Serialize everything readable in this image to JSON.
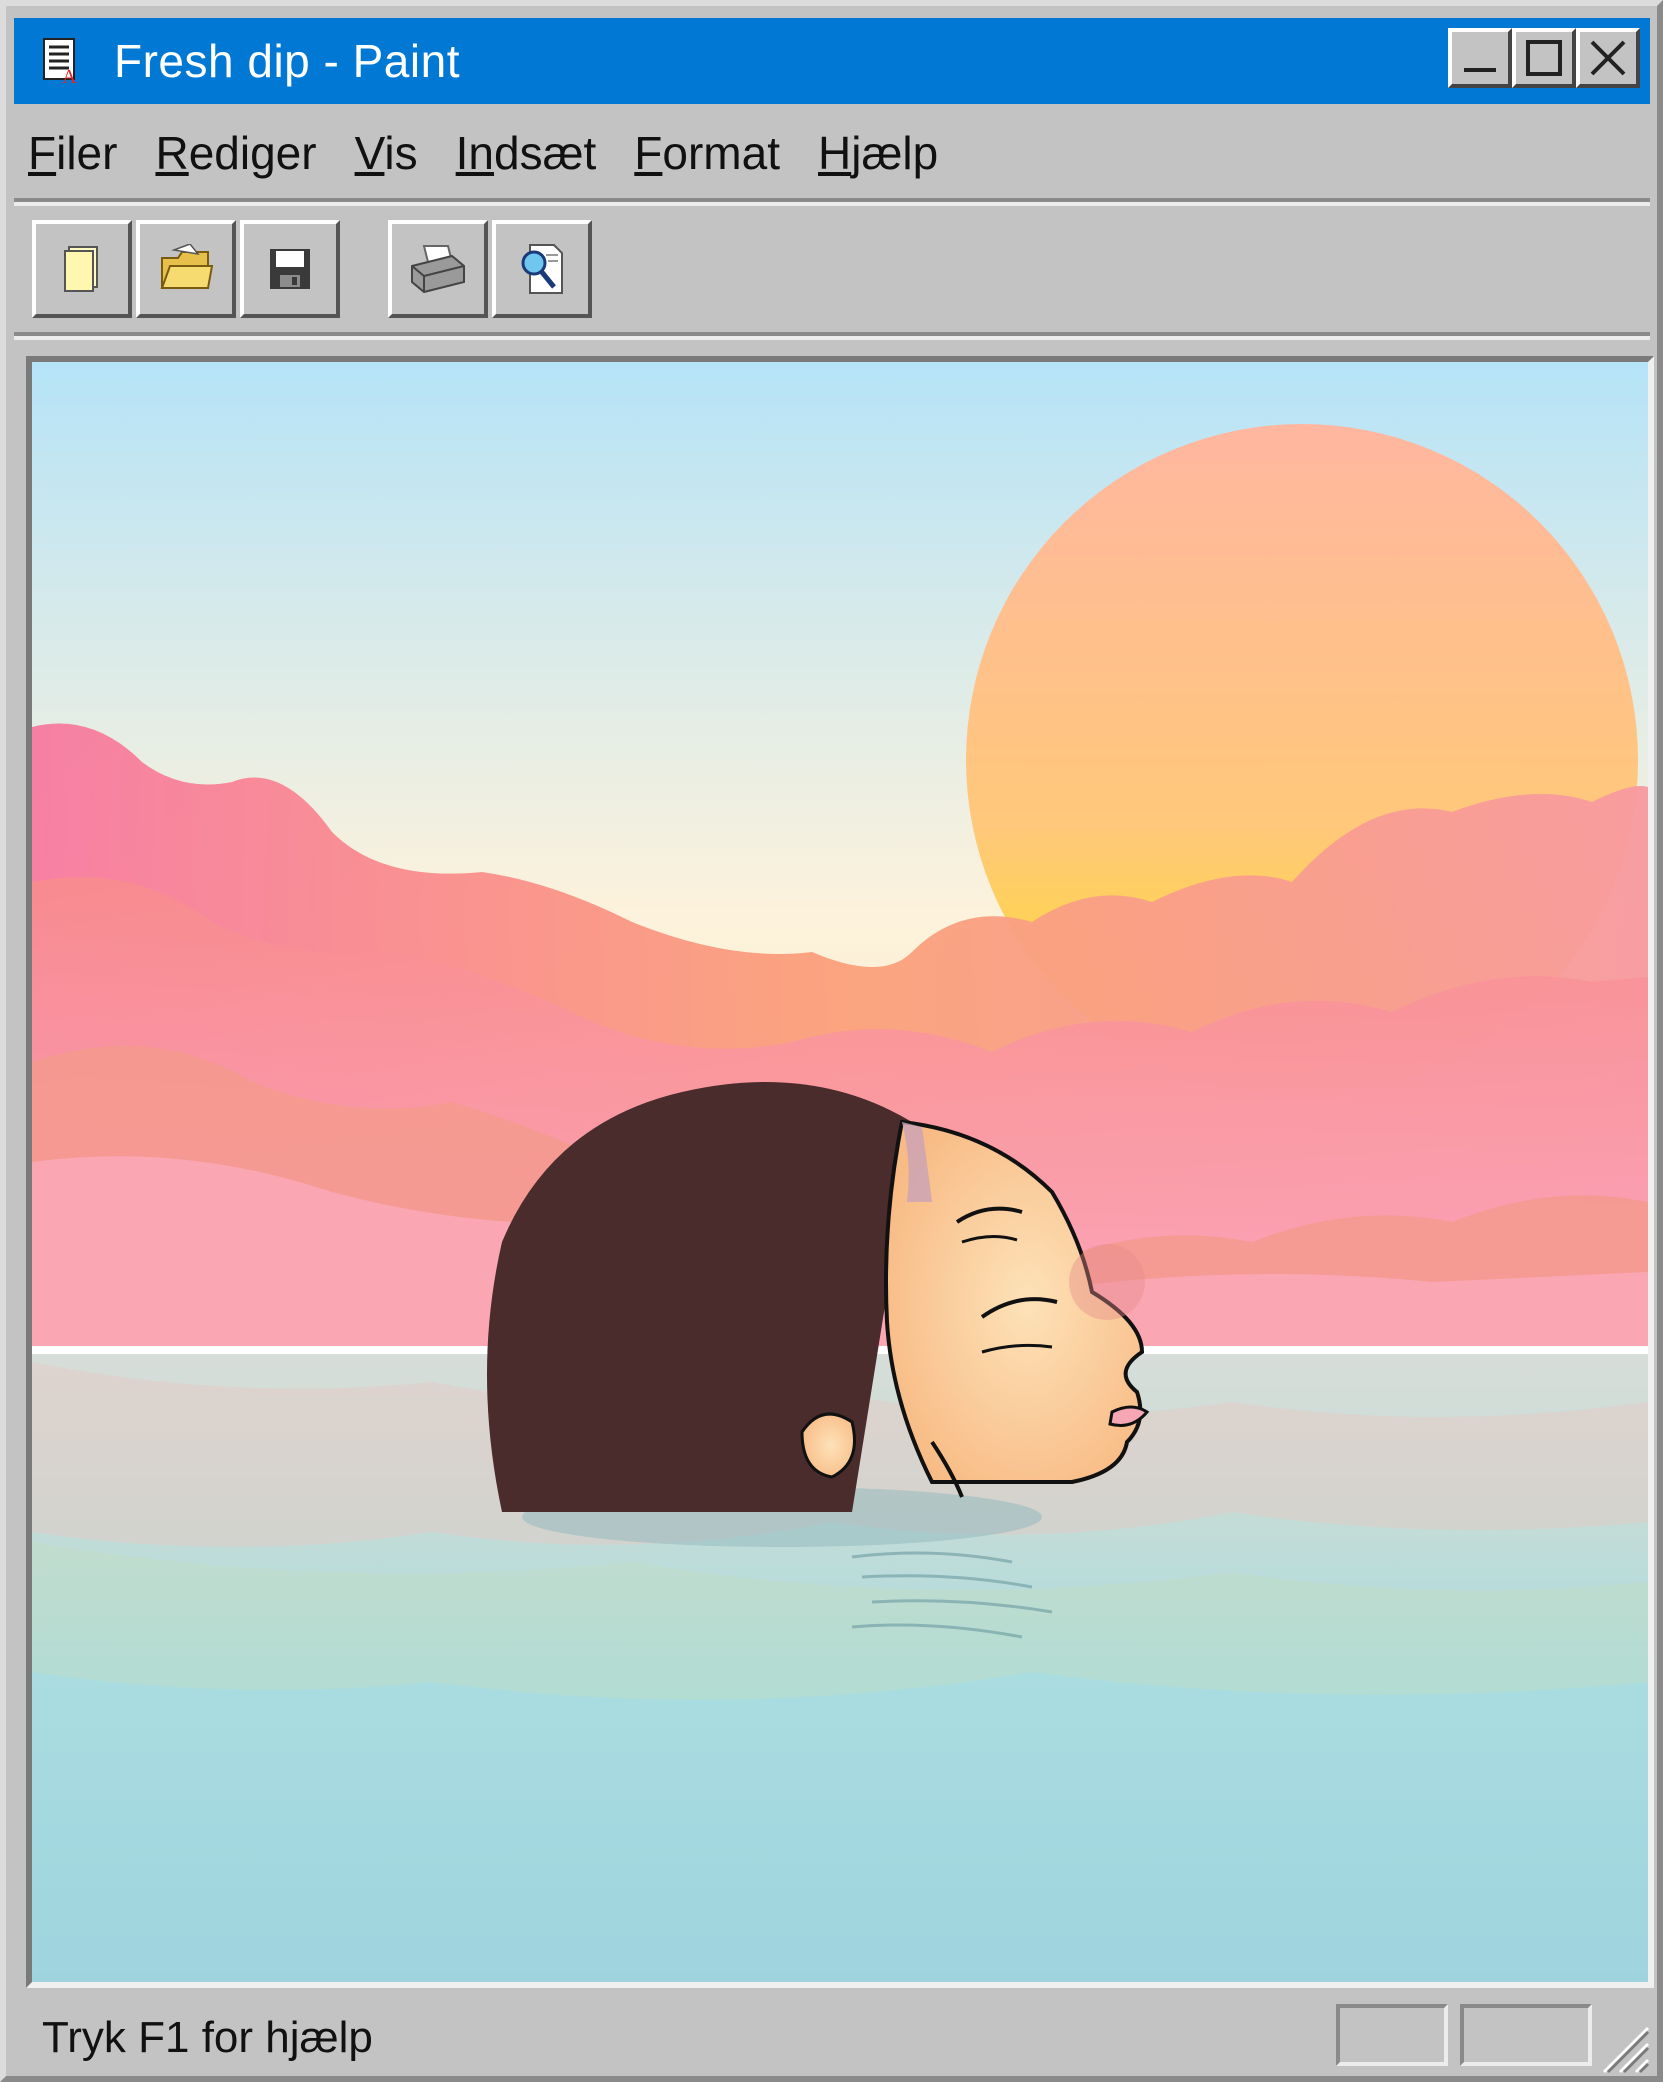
{
  "window": {
    "title": "Fresh dip - Paint",
    "controls": [
      "minimize",
      "maximize",
      "close"
    ]
  },
  "menu": {
    "items": [
      {
        "accel": "F",
        "rest": "iler"
      },
      {
        "accel": "R",
        "rest": "ediger"
      },
      {
        "accel": "V",
        "rest": "is"
      },
      {
        "accel": "In",
        "rest": "dsæt"
      },
      {
        "accel": "F",
        "rest": "ormat"
      },
      {
        "accel": "H",
        "rest": "jælp"
      }
    ]
  },
  "toolbar": {
    "buttons": [
      "new-icon",
      "open-folder-icon",
      "save-disk-icon",
      "print-icon",
      "print-preview-icon"
    ]
  },
  "canvas": {
    "artwork": "woman's head in water at sunset with pink clouds",
    "colors": {
      "sky_top": "#b5e3f7",
      "sky_bottom": "#fdf2dc",
      "sun_top": "#ffb7a0",
      "sun_bottom": "#ffe21a",
      "clouds": "#f79aa0",
      "water": "#a6d6de",
      "hair": "#4a2c2c",
      "skin": "#fbc99a"
    }
  },
  "status": {
    "text": "Tryk F1 for hjælp"
  },
  "colors": {
    "titlebar": "#0078d4",
    "chrome": "#c3c3c3"
  }
}
